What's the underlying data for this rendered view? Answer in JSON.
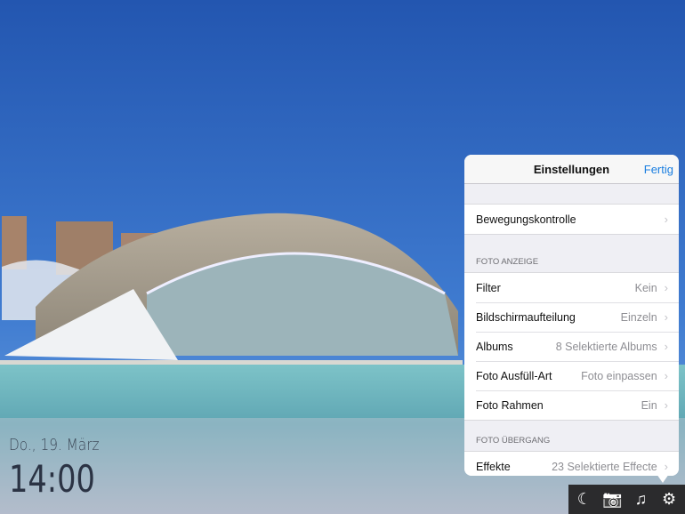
{
  "clock": {
    "date": "Do., 19. März",
    "time": "14:00"
  },
  "panel": {
    "title": "Einstellungen",
    "done": "Fertig",
    "motion": {
      "label": "Bewegungskontrolle"
    },
    "section1": "FOTO ANZEIGE",
    "rows": [
      {
        "label": "Filter",
        "value": "Kein"
      },
      {
        "label": "Bildschirmaufteilung",
        "value": "Einzeln"
      },
      {
        "label": "Albums",
        "value": "8 Selektierte Albums"
      },
      {
        "label": "Foto Ausfüll-Art",
        "value": "Foto einpassen"
      },
      {
        "label": "Foto Rahmen",
        "value": "Ein"
      }
    ],
    "section2": "FOTO ÜBERGANG",
    "effects": {
      "label": "Effekte",
      "value": "23 Selektierte Effecte"
    },
    "chevron": "›"
  },
  "toolbar": {
    "icons": [
      "moon-icon",
      "camera-icon",
      "music-icon",
      "gear-icon"
    ],
    "glyphs": [
      "☾",
      "📷",
      "♫",
      "⚙"
    ]
  },
  "colors": {
    "accent": "#1a7ee0"
  }
}
